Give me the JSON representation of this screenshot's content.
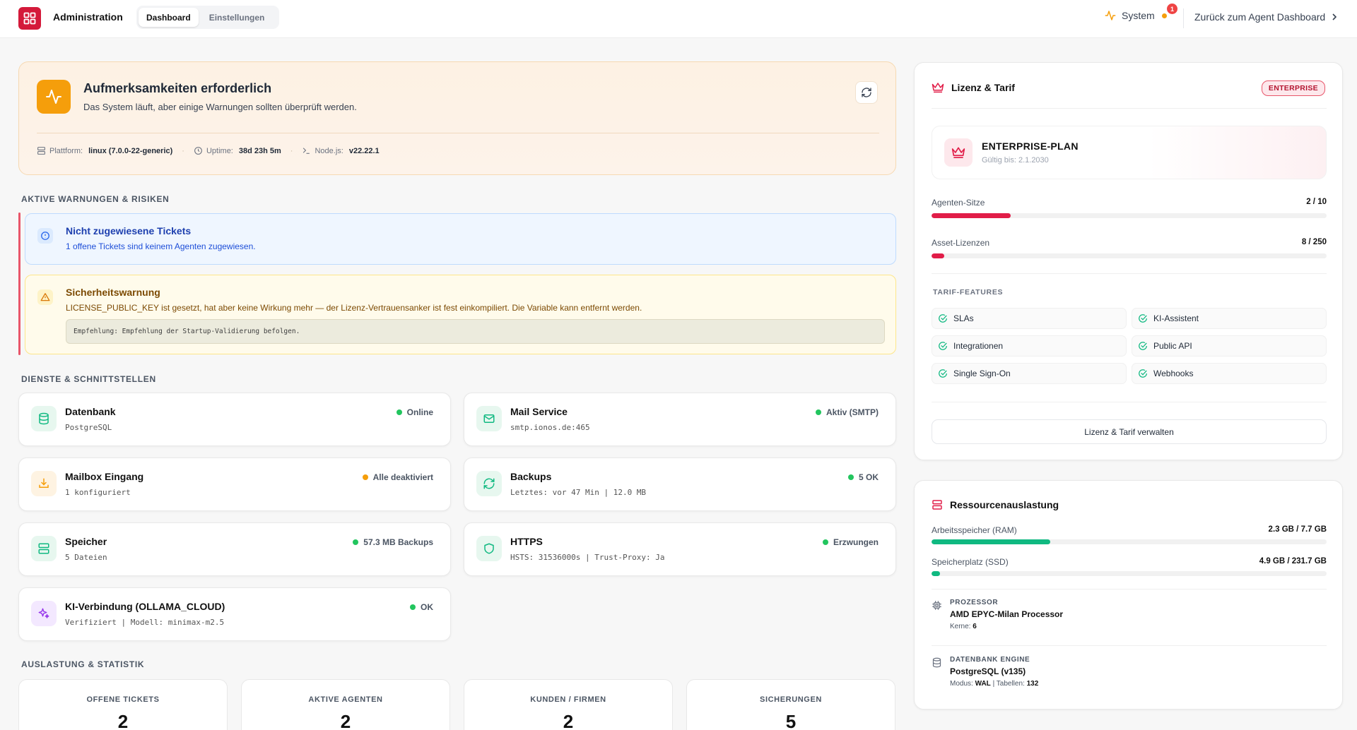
{
  "header": {
    "app_title": "Administration",
    "tabs": [
      {
        "label": "Dashboard",
        "active": true
      },
      {
        "label": "Einstellungen",
        "active": false
      }
    ],
    "system_label": "System",
    "notification_count": "1",
    "back_label": "Zurück zum Agent Dashboard"
  },
  "attention": {
    "title": "Aufmerksamkeiten erforderlich",
    "subtitle": "Das System läuft, aber einige Warnungen sollten überprüft werden.",
    "platform_label": "Plattform:",
    "platform_value": "linux (7.0.0-22-generic)",
    "uptime_label": "Uptime:",
    "uptime_value": "38d 23h 5m",
    "node_label": "Node.js:",
    "node_value": "v22.22.1"
  },
  "sections": {
    "warnings": "AKTIVE WARNUNGEN & RISIKEN",
    "services": "DIENSTE & SCHNITTSTELLEN",
    "stats": "AUSLASTUNG & STATISTIK"
  },
  "warnings": [
    {
      "title": "Nicht zugewiesene Tickets",
      "text": "1 offene Tickets sind keinem Agenten zugewiesen."
    },
    {
      "title": "Sicherheitswarnung",
      "text": "LICENSE_PUBLIC_KEY ist gesetzt, hat aber keine Wirkung mehr — der Lizenz-Vertrauensanker ist fest einkompiliert. Die Variable kann entfernt werden.",
      "code": "Empfehlung: Empfehlung der Startup-Validierung befolgen."
    }
  ],
  "services": [
    {
      "icon": "database-icon",
      "title": "Datenbank",
      "sub": "PostgreSQL",
      "status": "Online",
      "status_color": "#22c55e"
    },
    {
      "icon": "mail-icon",
      "title": "Mail Service",
      "sub": "smtp.ionos.de:465",
      "status": "Aktiv (SMTP)",
      "status_color": "#22c55e"
    },
    {
      "icon": "download-icon",
      "title": "Mailbox Eingang",
      "sub": "1 konfiguriert",
      "status": "Alle deaktiviert",
      "status_color": "#f59e0b"
    },
    {
      "icon": "refresh-icon",
      "title": "Backups",
      "sub": "Letztes: vor 47 Min | 12.0 MB",
      "status": "5 OK",
      "status_color": "#22c55e"
    },
    {
      "icon": "server-icon",
      "title": "Speicher",
      "sub": "5 Dateien",
      "status": "57.3 MB Backups",
      "status_color": "#22c55e"
    },
    {
      "icon": "shield-icon",
      "title": "HTTPS",
      "sub": "HSTS: 31536000s | Trust-Proxy: Ja",
      "status": "Erzwungen",
      "status_color": "#22c55e"
    },
    {
      "icon": "sparkles-icon",
      "title": "KI-Verbindung (OLLAMA_CLOUD)",
      "sub": "Verifiziert | Modell: minimax-m2.5",
      "status": "OK",
      "status_color": "#22c55e"
    }
  ],
  "stats": [
    {
      "label": "OFFENE TICKETS",
      "value": "2"
    },
    {
      "label": "AKTIVE AGENTEN",
      "value": "2"
    },
    {
      "label": "KUNDEN / FIRMEN",
      "value": "2"
    },
    {
      "label": "SICHERUNGEN",
      "value": "5"
    }
  ],
  "license": {
    "title": "Lizenz & Tarif",
    "badge": "ENTERPRISE",
    "plan_name": "ENTERPRISE-PLAN",
    "plan_valid": "Gültig bis: 2.1.2030",
    "seats_label": "Agenten-Sitze",
    "seats_value": "2 / 10",
    "seats_fraction": 0.2,
    "assets_label": "Asset-Lizenzen",
    "assets_value": "8 / 250",
    "assets_fraction": 0.032,
    "features_title": "TARIF-FEATURES",
    "features": [
      "SLAs",
      "KI-Assistent",
      "Integrationen",
      "Public API",
      "Single Sign-On",
      "Webhooks"
    ],
    "manage_label": "Lizenz & Tarif verwalten",
    "accent": "#e11d48"
  },
  "resources": {
    "title": "Ressourcenauslastung",
    "ram_label": "Arbeitsspeicher (RAM)",
    "ram_value": "2.3 GB / 7.7 GB",
    "ram_fraction": 0.3,
    "ssd_label": "Speicherplatz (SSD)",
    "ssd_value": "4.9 GB / 231.7 GB",
    "ssd_fraction": 0.021,
    "cpu_title": "PROZESSOR",
    "cpu_name": "AMD EPYC-Milan Processor",
    "cpu_cores_label": "Kerne:",
    "cpu_cores": "6",
    "db_title": "DATENBANK ENGINE",
    "db_name": "PostgreSQL (v135)",
    "db_mode_label": "Modus:",
    "db_mode": "WAL",
    "db_tables_label": "| Tabellen:",
    "db_tables": "132",
    "bar_color": "#10b981"
  }
}
